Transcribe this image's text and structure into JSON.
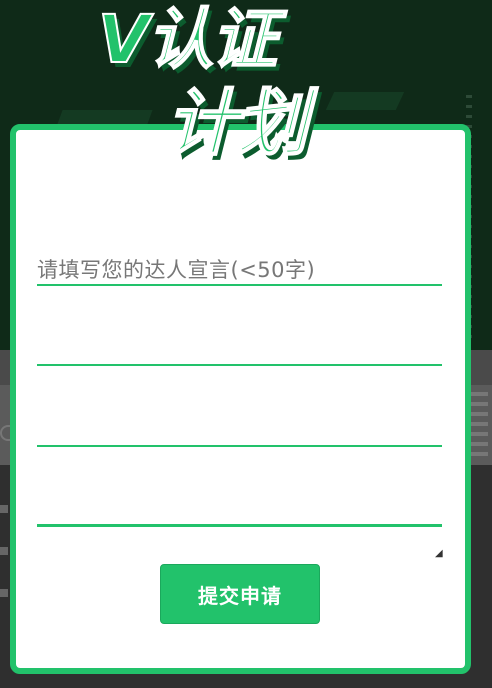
{
  "title": {
    "line1": "V认证",
    "line2": "计划"
  },
  "form": {
    "placeholder": "请填写您的达人宣言(<50字)",
    "submit_label": "提交申请"
  },
  "colors": {
    "accent": "#22c26b",
    "background_top": "#0f2a18",
    "overlay": "#3e3e3e"
  }
}
